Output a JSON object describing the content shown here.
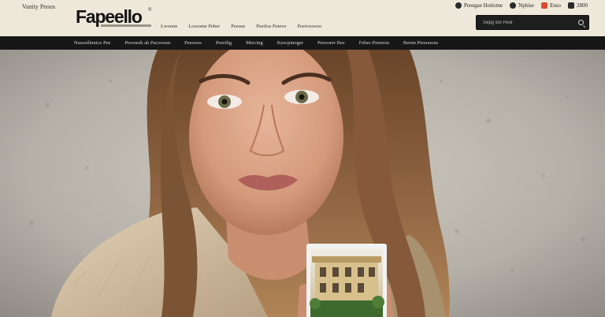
{
  "header": {
    "tagline": "Vanity Peoos",
    "logo": "Fapeello",
    "logo_mark": "®",
    "top_links": [
      "Lwoone",
      "Lossome Peber",
      "Peeuse",
      "Peeiloe Peteve",
      "Peerioowoo"
    ]
  },
  "utility": {
    "items": [
      {
        "label": "Peeegae Hotlome",
        "icon": "user-icon"
      },
      {
        "label": "Nphise",
        "icon": "account-icon"
      },
      {
        "label": "Enso",
        "icon": "badge-icon"
      },
      {
        "label": "2800",
        "icon": "cart-icon"
      }
    ]
  },
  "search": {
    "placeholder": "Sepg loo Peor"
  },
  "nav": {
    "items": [
      "Nassoilinnice Pee",
      "Preosesh ah Pacoooen",
      "Peeooos",
      "Peerilig",
      "Miecing",
      "Keecpinoger",
      "Peeoorer Bee",
      "Febes Penreon",
      "Bernn Pieeooons"
    ]
  },
  "hero": {
    "accent_colors": {
      "background_wall": "#bdb9b2",
      "hair": "#7a5434",
      "sweater": "#d8c4a6",
      "photo_card_border": "#f2f2f2"
    },
    "photo_card_icon": "house-photo-icon"
  }
}
